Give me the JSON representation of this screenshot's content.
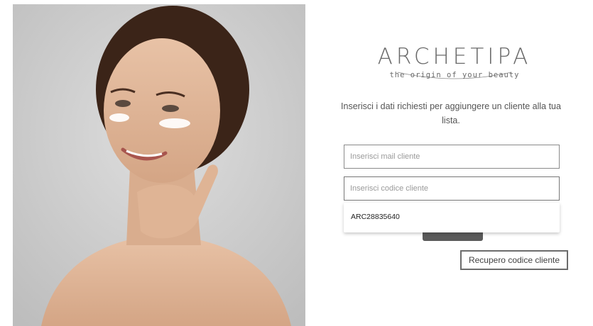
{
  "hero": {
    "image_alt": "woman-with-skincare-cream"
  },
  "brand": {
    "name": "ARCHETIPA",
    "tagline": "the origin of your beauty"
  },
  "form": {
    "intro": "Inserisci i dati richiesti per aggiungere un cliente alla tua lista.",
    "mail_placeholder": "Inserisci mail cliente",
    "mail_value": "",
    "codice_placeholder": "Inserisci codice cliente",
    "codice_value": "",
    "suggestions": [
      "ARC28835640"
    ],
    "recover_label": "Recupero codice cliente"
  },
  "colors": {
    "button_dark": "#5a5a5a",
    "border": "#8a8a8a",
    "text": "#555555"
  }
}
